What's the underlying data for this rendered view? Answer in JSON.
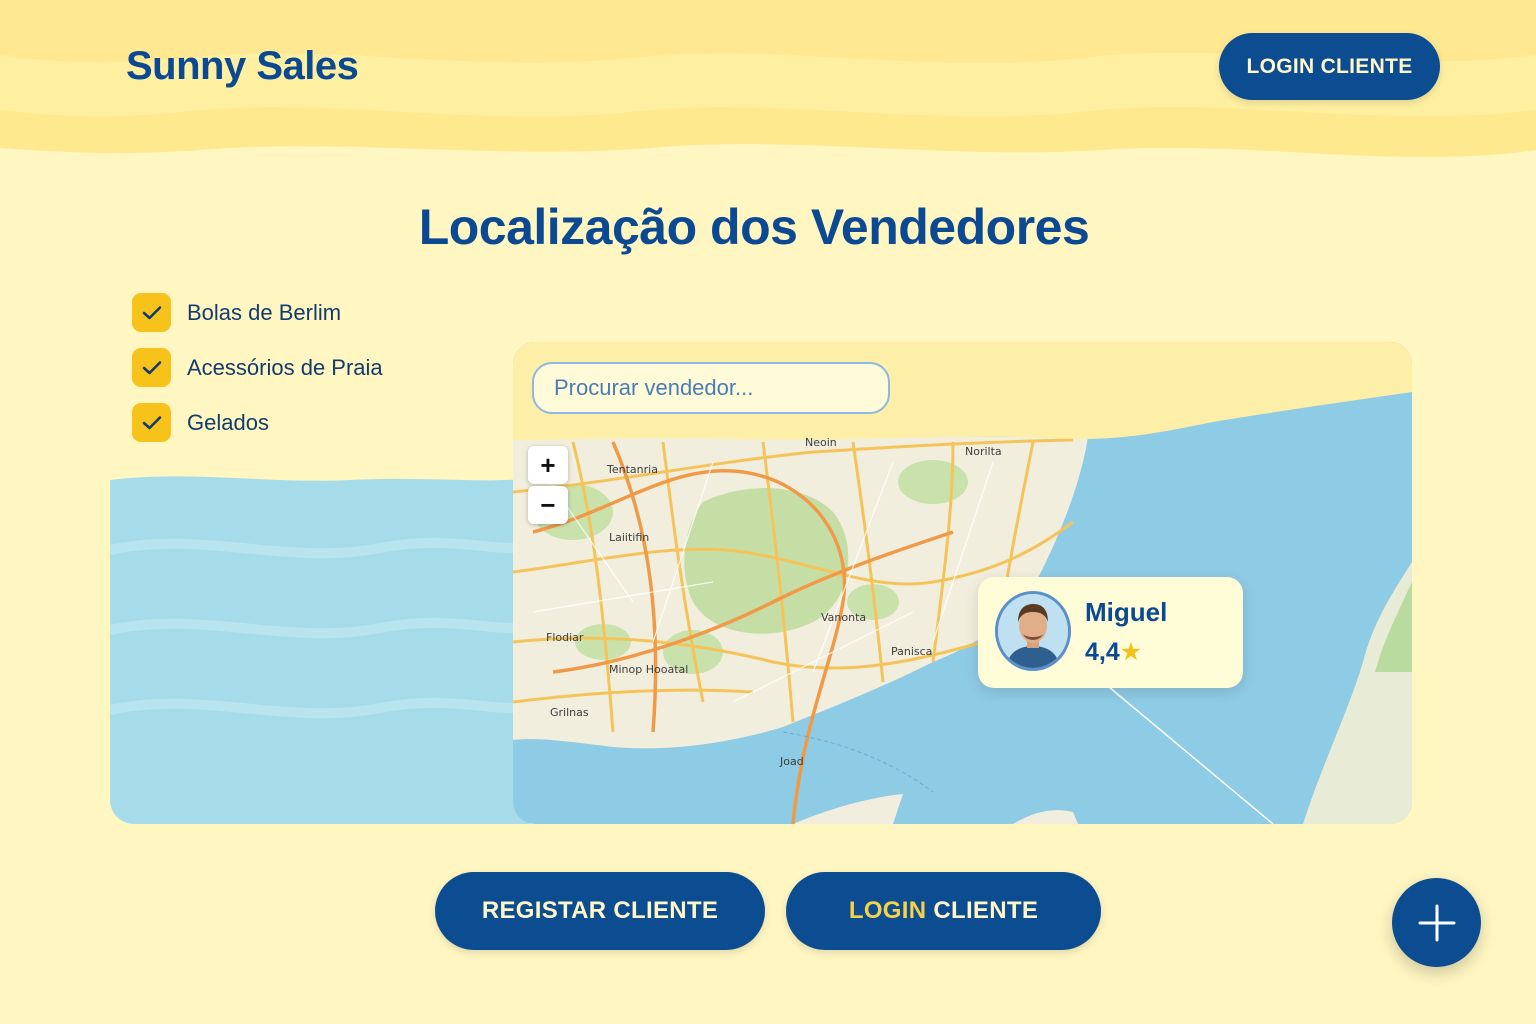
{
  "brand": {
    "name": "Sunny Sales"
  },
  "header": {
    "login_label": "LOGIN CLIENTE"
  },
  "page": {
    "title": "Localização dos Vendedores"
  },
  "filters": [
    {
      "label": "Bolas de Berlim",
      "checked": true
    },
    {
      "label": "Acessórios de Praia",
      "checked": true
    },
    {
      "label": "Gelados",
      "checked": true
    }
  ],
  "map": {
    "search_placeholder": "Procurar vendedor...",
    "zoom_in": "+",
    "zoom_out": "−",
    "labels": [
      "Neoin",
      "Norilta",
      "Tentanria",
      "Laiitifin",
      "Vanonta",
      "Panisca",
      "Flodiar",
      "Minop Hooatal",
      "Grilnas",
      "Joad"
    ]
  },
  "seller": {
    "name": "Miguel",
    "rating": "4,4",
    "star": "★"
  },
  "actions": {
    "register_label": "REGISTAR CLIENTE",
    "login_accent": "LOGIN",
    "login_rest": "CLIENTE"
  },
  "colors": {
    "primary": "#0c4c90",
    "accent": "#f7c21a",
    "background": "#fff6c2",
    "sea": "#8ecbe4"
  },
  "icons": {
    "fab": "plus-icon",
    "checkbox": "check-icon"
  }
}
